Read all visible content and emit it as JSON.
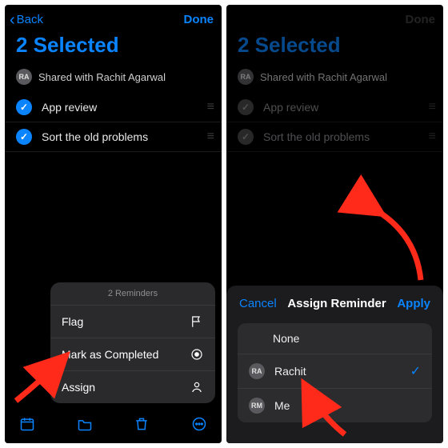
{
  "colors": {
    "accent": "#0a84ff"
  },
  "nav": {
    "back": "Back",
    "done": "Done"
  },
  "page_title": "2 Selected",
  "shared": {
    "initials": "RA",
    "text": "Shared with Rachit Agarwal"
  },
  "reminders": [
    {
      "label": "App review"
    },
    {
      "label": "Sort the old problems"
    }
  ],
  "popover": {
    "header": "2 Reminders",
    "items": [
      {
        "label": "Flag"
      },
      {
        "label": "Mark as Completed"
      },
      {
        "label": "Assign"
      }
    ]
  },
  "sheet": {
    "cancel": "Cancel",
    "title": "Assign Reminder",
    "apply": "Apply",
    "options": [
      {
        "label": "None"
      },
      {
        "initials": "RA",
        "label": "Rachit",
        "selected": true
      },
      {
        "initials": "RM",
        "label": "Me"
      }
    ]
  }
}
